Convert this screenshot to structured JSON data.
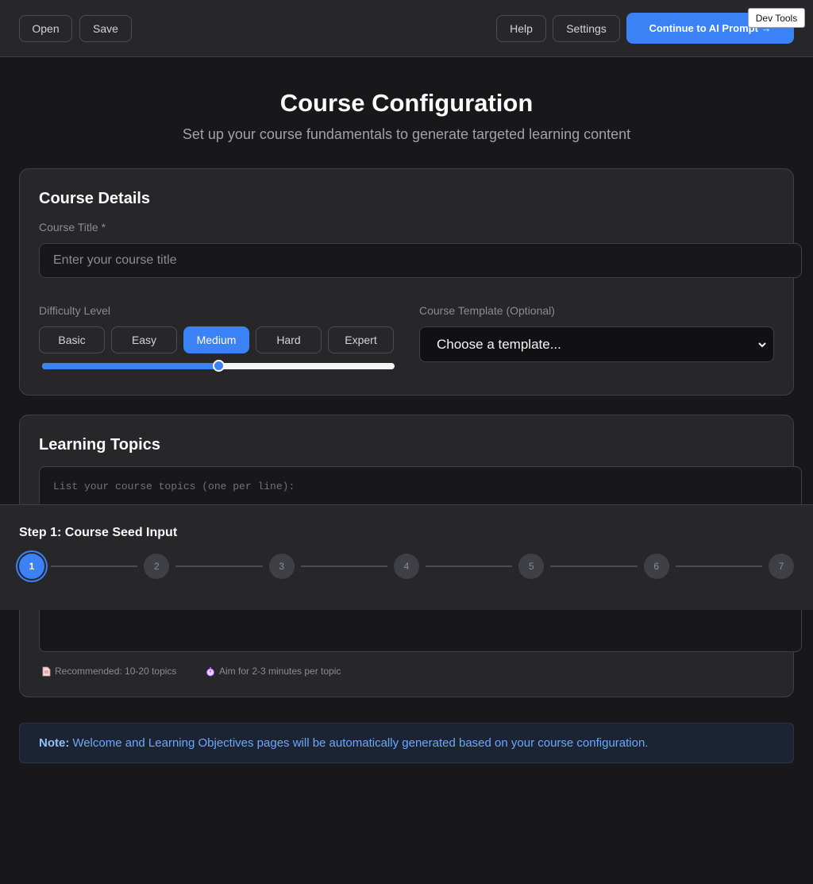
{
  "toolbar": {
    "open_label": "Open",
    "save_label": "Save",
    "help_label": "Help",
    "settings_label": "Settings",
    "continue_label": "Continue to AI Prompt →",
    "devtools_label": "Dev Tools"
  },
  "header": {
    "title": "Course Configuration",
    "subtitle": "Set up your course fundamentals to generate targeted learning content"
  },
  "course_details": {
    "title": "Course Details",
    "course_title_label": "Course Title *",
    "course_title_placeholder": "Enter your course title",
    "difficulty_label": "Difficulty Level",
    "difficulty_options": [
      "Basic",
      "Easy",
      "Medium",
      "Hard",
      "Expert"
    ],
    "difficulty_selected": "Medium",
    "difficulty_level_fraction": 0.5,
    "template_label": "Course Template (Optional)",
    "template_selected": "Choose a template..."
  },
  "learning_topics": {
    "title": "Learning Topics",
    "placeholder": "List your course topics (one per line):",
    "hint_topics": "Recommended: 10-20 topics",
    "hint_time": "Aim for 2-3 minutes per topic",
    "hint_topics_icon": "document-icon",
    "hint_time_icon": "stopwatch-icon"
  },
  "stepper": {
    "title": "Step 1: Course Seed Input",
    "steps": [
      "1",
      "2",
      "3",
      "4",
      "5",
      "6",
      "7"
    ],
    "active_step": "1"
  },
  "note": {
    "label": "Note:",
    "text": "Welcome and Learning Objectives pages will be automatically generated based on your course configuration."
  },
  "colors": {
    "accent": "#3b82f6",
    "background": "#18181b",
    "card": "#27272a"
  }
}
